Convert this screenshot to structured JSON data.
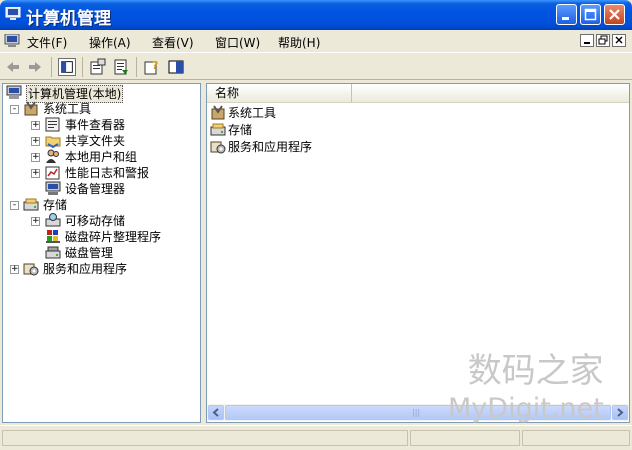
{
  "window": {
    "title": "计算机管理"
  },
  "menu": {
    "items": [
      "文件(F)",
      "操作(A)",
      "查看(V)",
      "窗口(W)",
      "帮助(H)"
    ]
  },
  "tree": {
    "root": "计算机管理(本地)",
    "system_tools": "系统工具",
    "event_viewer": "事件查看器",
    "shared_folders": "共享文件夹",
    "local_users": "本地用户和组",
    "perf_logs": "性能日志和警报",
    "device_manager": "设备管理器",
    "storage": "存储",
    "removable_storage": "可移动存储",
    "disk_defrag": "磁盘碎片整理程序",
    "disk_management": "磁盘管理",
    "services_apps": "服务和应用程序",
    "expander_plus": "+",
    "expander_minus": "-"
  },
  "list": {
    "column_name": "名称",
    "items": [
      "系统工具",
      "存储",
      "服务和应用程序"
    ],
    "scroll_grip": "|||"
  },
  "watermark": {
    "line1": "数码之家",
    "line2": "MyDigit.net"
  },
  "colors": {
    "titlebar": "#0054e3",
    "selection": "#ece9d8"
  }
}
